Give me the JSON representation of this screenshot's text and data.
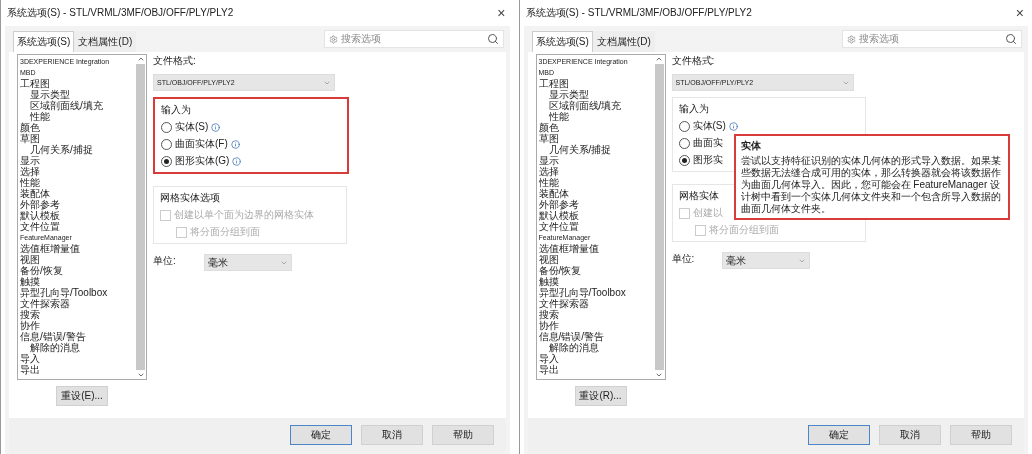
{
  "dialogs": [
    {
      "title": "系统选项(S) - STL/VRML/3MF/OBJ/OFF/PLY/PLY2",
      "close": "×",
      "tabs": [
        {
          "label": "系统选项(S)",
          "selected": true
        },
        {
          "label": "文档属性(D)",
          "selected": false
        }
      ],
      "search": {
        "placeholder": "搜索选项"
      },
      "tree": [
        {
          "label": "3DEXPERIENCE Integration"
        },
        {
          "label": "MBD"
        },
        {
          "label": "工程图",
          "children": [
            {
              "label": "显示类型"
            },
            {
              "label": "区域剖面线/填充"
            },
            {
              "label": "性能"
            }
          ]
        },
        {
          "label": "颜色"
        },
        {
          "label": "草图",
          "children": [
            {
              "label": "几何关系/捕捉"
            }
          ]
        },
        {
          "label": "显示"
        },
        {
          "label": "选择"
        },
        {
          "label": "性能"
        },
        {
          "label": "装配体"
        },
        {
          "label": "外部参考"
        },
        {
          "label": "默认模板"
        },
        {
          "label": "文件位置"
        },
        {
          "label": "FeatureManager"
        },
        {
          "label": "选值框增量值"
        },
        {
          "label": "视图"
        },
        {
          "label": "备份/恢复"
        },
        {
          "label": "触摸"
        },
        {
          "label": "异型孔向导/Toolbox"
        },
        {
          "label": "文件探索器"
        },
        {
          "label": "搜索"
        },
        {
          "label": "协作"
        },
        {
          "label": "信息/错误/警告",
          "children": [
            {
              "label": "解除的消息"
            }
          ]
        },
        {
          "label": "导入"
        },
        {
          "label": "导出"
        }
      ],
      "file_format": {
        "label": "文件格式:",
        "value": "STL/OBJ/OFF/PLY/PLY2"
      },
      "import_group": {
        "title": "输入为",
        "highlighted": true,
        "options": [
          {
            "label": "实体(S)",
            "selected": false,
            "info": true
          },
          {
            "label": "曲面实体(F)",
            "selected": false,
            "info": true
          },
          {
            "label": "图形实体(G)",
            "selected": true,
            "info": true
          }
        ]
      },
      "mesh_group": {
        "title": "网格实体选项",
        "options": [
          {
            "label": "创建以单个面为边界的网格实体",
            "checked": false,
            "disabled": true,
            "children": [
              {
                "label": "将分面分组到面",
                "checked": false,
                "disabled": true
              }
            ]
          }
        ]
      },
      "unit": {
        "label": "单位:",
        "value": "毫米"
      },
      "reset_button": "重设(E)...",
      "buttons": [
        {
          "label": "确定",
          "default": true
        },
        {
          "label": "取消",
          "default": false
        },
        {
          "label": "帮助",
          "default": false
        }
      ]
    },
    {
      "title": "系统选项(S) - STL/VRML/3MF/OBJ/OFF/PLY/PLY2",
      "close": "×",
      "tabs": [
        {
          "label": "系统选项(S)",
          "selected": true
        },
        {
          "label": "文档属性(D)",
          "selected": false
        }
      ],
      "search": {
        "placeholder": "搜索选项"
      },
      "tree": [
        {
          "label": "3DEXPERIENCE Integration"
        },
        {
          "label": "MBD"
        },
        {
          "label": "工程图",
          "children": [
            {
              "label": "显示类型"
            },
            {
              "label": "区域剖面线/填充"
            },
            {
              "label": "性能"
            }
          ]
        },
        {
          "label": "颜色"
        },
        {
          "label": "草图",
          "children": [
            {
              "label": "几何关系/捕捉"
            }
          ]
        },
        {
          "label": "显示"
        },
        {
          "label": "选择"
        },
        {
          "label": "性能"
        },
        {
          "label": "装配体"
        },
        {
          "label": "外部参考"
        },
        {
          "label": "默认模板"
        },
        {
          "label": "文件位置"
        },
        {
          "label": "FeatureManager"
        },
        {
          "label": "选值框增量值"
        },
        {
          "label": "视图"
        },
        {
          "label": "备份/恢复"
        },
        {
          "label": "触摸"
        },
        {
          "label": "异型孔向导/Toolbox"
        },
        {
          "label": "文件探索器"
        },
        {
          "label": "搜索"
        },
        {
          "label": "协作"
        },
        {
          "label": "信息/错误/警告",
          "children": [
            {
              "label": "解除的消息"
            }
          ]
        },
        {
          "label": "导入"
        },
        {
          "label": "导出"
        }
      ],
      "file_format": {
        "label": "文件格式:",
        "value": "STL/OBJ/OFF/PLY/PLY2"
      },
      "import_group": {
        "title": "输入为",
        "highlighted": false,
        "options": [
          {
            "label": "实体(S)",
            "selected": false,
            "info": true
          },
          {
            "label": "曲面实",
            "selected": false,
            "info": false
          },
          {
            "label": "图形实",
            "selected": true,
            "info": false
          }
        ]
      },
      "mesh_group": {
        "title": "网格实体",
        "options": [
          {
            "label": "创建以",
            "checked": false,
            "disabled": true,
            "children": [
              {
                "label": "将分面分组到面",
                "checked": false,
                "disabled": true
              }
            ]
          }
        ]
      },
      "unit": {
        "label": "单位:",
        "value": "毫米"
      },
      "reset_button": "重设(R)...",
      "buttons": [
        {
          "label": "确定",
          "default": true
        },
        {
          "label": "取消",
          "default": false
        },
        {
          "label": "帮助",
          "default": false
        }
      ],
      "tooltip": {
        "title": "实体",
        "text": "尝试以支持特征识别的实体几何体的形式导入数据。如果某些数据无法缝合成可用的实体，那么转换器就会将该数据作为曲面几何体导入。因此，您可能会在 FeatureManager 设计树中看到一个实体几何体文件夹和一个包含所导入数据的曲面几何体文件夹。",
        "highlighted": true
      }
    }
  ]
}
